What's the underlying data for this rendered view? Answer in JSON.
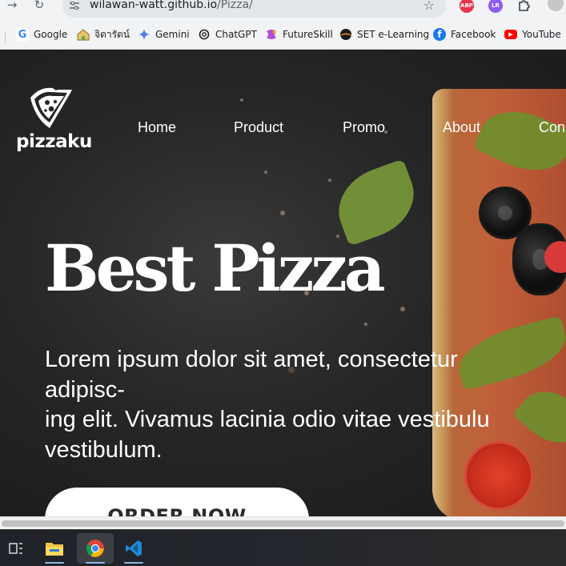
{
  "browser": {
    "url_host": "wilawan-watt.github.io",
    "url_path": "/Pizza/",
    "nav_icons": [
      "forward-icon",
      "reload-icon"
    ],
    "extensions": [
      {
        "name": "adblock-extension",
        "label": "ABP",
        "color": "#e8344a"
      },
      {
        "name": "profile-extension",
        "label": "LR",
        "color": "#8b5cf6"
      },
      {
        "name": "extensions-puzzle",
        "label": "",
        "color": "#5f6368"
      }
    ],
    "bookmarks": [
      {
        "label": "Google",
        "icon": "google-icon"
      },
      {
        "label": "จิตารัตน์",
        "icon": "house-icon"
      },
      {
        "label": "Gemini",
        "icon": "gemini-icon"
      },
      {
        "label": "ChatGPT",
        "icon": "chatgpt-icon"
      },
      {
        "label": "FutureSkill",
        "icon": "futureskill-icon"
      },
      {
        "label": "SET e-Learning",
        "icon": "set-icon"
      },
      {
        "label": "Facebook",
        "icon": "facebook-icon"
      },
      {
        "label": "YouTube",
        "icon": "youtube-icon"
      }
    ]
  },
  "site": {
    "logo_text": "pizzaku",
    "nav": [
      "Home",
      "Product",
      "Promo",
      "About",
      "Con"
    ],
    "hero_title": "Best Pizza",
    "hero_lines": [
      "Lorem ipsum dolor sit amet, consectetur",
      "adipisc-",
      "ing elit. Vivamus lacinia odio vitae vestibulu",
      "vestibulum."
    ],
    "cta_label": "ORDER NOW"
  },
  "taskbar": {
    "apps": [
      "task-view-icon",
      "file-explorer-icon",
      "chrome-icon",
      "vscode-icon"
    ],
    "active": "chrome-icon"
  },
  "colors": {
    "page_bg": "#262626",
    "text": "#ffffff",
    "button_bg": "#ffffff",
    "button_text": "#2a2a2a"
  }
}
